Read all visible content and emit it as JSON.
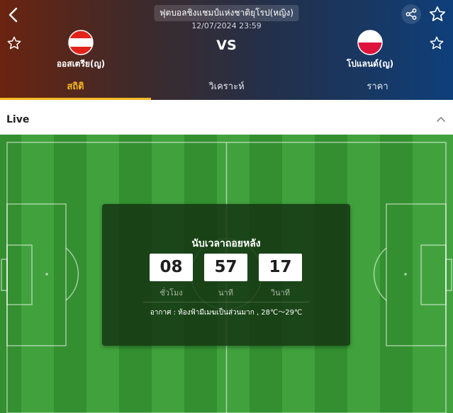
{
  "header": {
    "league_name": "ฟุตบอลชิงแชมป์แห่งชาติยุโรป(หญิง)",
    "match_datetime": "12/07/2024 23:59",
    "vs_label": "VS",
    "home_team": {
      "name": "ออสเตรีย(ญ)",
      "flag_colors": [
        "#e2231a",
        "#ffffff",
        "#e2231a"
      ]
    },
    "away_team": {
      "name": "โปแลนด์(ญ)",
      "flag_colors": [
        "#ffffff",
        "#dc143c"
      ]
    },
    "icons": [
      "back-arrow-icon",
      "share-icon",
      "star-outline-icon"
    ]
  },
  "tabs": [
    {
      "label": "สถิติ",
      "active": true
    },
    {
      "label": "วิเคราะห์",
      "active": false
    },
    {
      "label": "ราคา",
      "active": false
    }
  ],
  "live_section": {
    "title": "Live",
    "collapse_icon": "chevron-up-icon"
  },
  "countdown": {
    "title": "นับเวลาถอยหลัง",
    "hours": "08",
    "minutes": "57",
    "seconds": "17",
    "hours_label": "ชั่วโมง",
    "minutes_label": "นาที",
    "seconds_label": "วินาที",
    "weather": "อากาศ : ท้องฟ้ามีเมฆเป็นส่วนมาก , 28℃～29℃"
  },
  "colors": {
    "accent": "#f5b722",
    "header_left": "#6b2410",
    "header_right": "#0e3f7a",
    "pitch_light": "#3e9e3a",
    "pitch_dark": "#348f31"
  }
}
